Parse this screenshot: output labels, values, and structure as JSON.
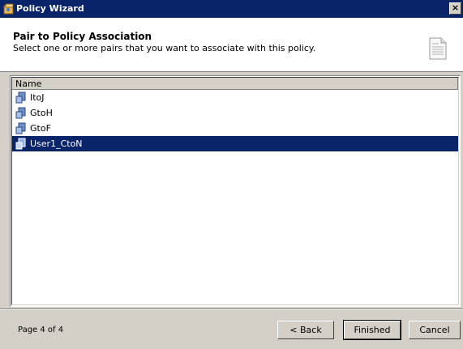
{
  "window": {
    "title": "Policy Wizard",
    "close_glyph": "×"
  },
  "header": {
    "title": "Pair to Policy Association",
    "subtitle": "Select one or more pairs that you want to associate with this policy."
  },
  "list": {
    "column_header": "Name",
    "items": [
      {
        "label": "ItoJ",
        "icon": "pair-icon",
        "selected": false
      },
      {
        "label": "GtoH",
        "icon": "pair-icon",
        "selected": false
      },
      {
        "label": "GtoF",
        "icon": "pair-icon",
        "selected": false
      },
      {
        "label": "User1_CtoN",
        "icon": "pair-icon",
        "selected": true
      }
    ]
  },
  "footer": {
    "page_indicator": "Page 4 of 4",
    "back_label": "< Back",
    "finished_label": "Finished",
    "cancel_label": "Cancel"
  },
  "colors": {
    "titlebar": "#0a246a",
    "selection": "#0a246a",
    "face": "#d4d0c8"
  }
}
